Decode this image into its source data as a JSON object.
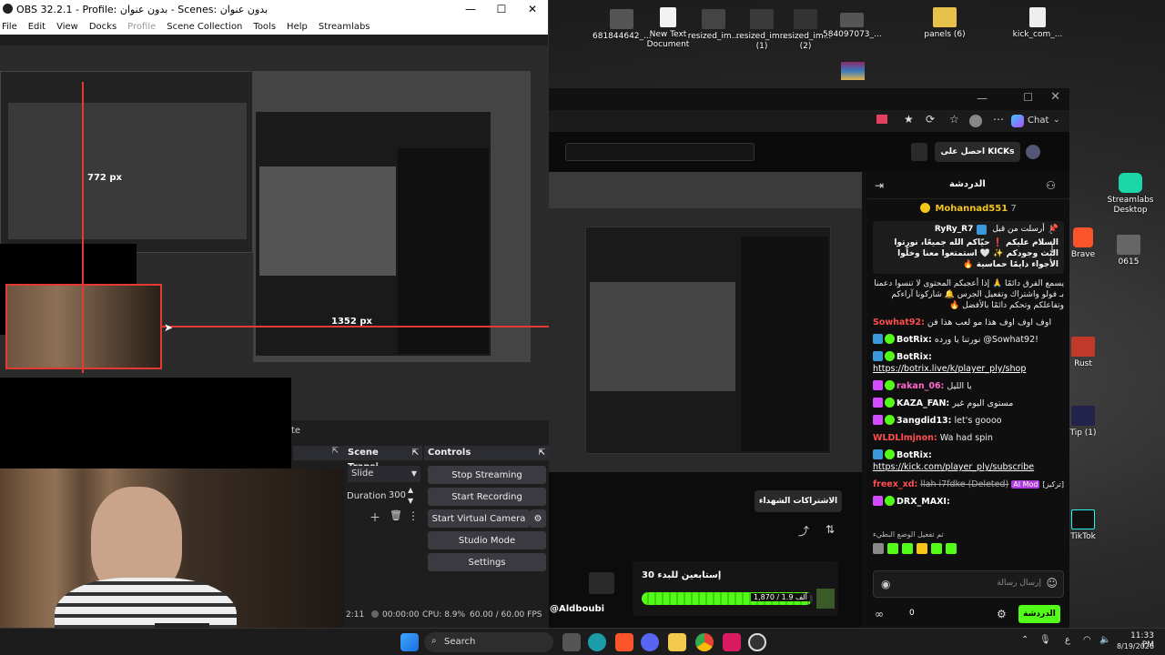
{
  "obs": {
    "title": "OBS 32.2.1 - Profile: بدون عنوان - Scenes: بدون عنوان",
    "menu": [
      "File",
      "Edit",
      "View",
      "Docks",
      "Profile",
      "Scene Collection",
      "Tools",
      "Help",
      "Streamlabs"
    ],
    "preview": {
      "measure_vertical": "772 px",
      "measure_horizontal": "1352 px"
    },
    "docks": {
      "transitions_title": "Scene Transi...",
      "transition_type": "Slide",
      "duration_label": "Duration",
      "duration_value": "300",
      "controls_title": "Controls",
      "controls": [
        "Stop Streaming",
        "Start Recording",
        "Start Virtual Camera",
        "Studio Mode",
        "Settings"
      ],
      "partial_label": "te"
    },
    "status": {
      "time_left": "2:11",
      "rec_time": "00:00:00",
      "cpu": "CPU: 8.9%",
      "fps": "60.00 / 60.00 FPS"
    }
  },
  "desktop": {
    "icons": [
      {
        "label": "681844642_...",
        "icon": "image-icon"
      },
      {
        "label": "New Text Document",
        "icon": "text-file-icon"
      },
      {
        "label": "resized_im...",
        "icon": "image-icon"
      },
      {
        "label": "resized_im... (1)",
        "icon": "image-icon"
      },
      {
        "label": "resized_im... (2)",
        "icon": "image-icon"
      },
      {
        "label": "584097073_...",
        "icon": "image-icon"
      },
      {
        "label": "panels (6)",
        "icon": "folder-icon"
      },
      {
        "label": "kick_com_...",
        "icon": "text-file-icon"
      }
    ],
    "right_icons": [
      {
        "label": "Streamlabs Desktop",
        "icon": "streamlabs-icon"
      },
      {
        "label": "Brave",
        "icon": "brave-icon"
      },
      {
        "label": "0615",
        "icon": "image-icon"
      },
      {
        "label": "Rust",
        "icon": "rust-icon"
      },
      {
        "label": "Tip (1)",
        "icon": "image-icon"
      },
      {
        "label": "TikTok",
        "icon": "tiktok-icon"
      }
    ]
  },
  "browser": {
    "chat_label": "Chat",
    "kicks_button": "احصل على KICKs",
    "chat_header": "الدردشة",
    "top_gifter": "Mohannad551",
    "top_gifter_count": "7",
    "pinned": {
      "by_label": "أرسلت من قبل",
      "user": "RyRy_R7",
      "text": "السلام عليكم ❗ حيّاكم الله جميعًا، نورتوا البث وجودكم ✨ 🤍 استمتعوا معنا وخلّوا الأجواء دايمًا حماسية 🔥"
    },
    "rules_text": "يسمع الفرق دائمًا 🙏 إذا أعجبكم المحتوى لا تنسوا دعمنا بـ فولو واشتراك وتفعيل الجرس 🔔 شاركونا آراءكم وتفاعلكم وتحكم دائمًا بالأفضل 🔥",
    "messages": [
      {
        "user": "Sowhat92:",
        "text": "اوف اوف اوف هذا مو لعب هذا فن",
        "color": "#ff4d4d",
        "badge": ""
      },
      {
        "user": "BotRix:",
        "text": "نورتنا يا ورده @Sowhat92!",
        "color": "#ffffff",
        "badge": "bot"
      },
      {
        "user": "BotRix:",
        "text": "https://botrix.live/k/player_ply/shop",
        "color": "#ffffff",
        "badge": "bot"
      },
      {
        "user": "rakan_06:",
        "text": "يا الليل",
        "color": "#ff66cc",
        "badge": "sub"
      },
      {
        "user": "KAZA_FAN:",
        "text": "مستوى اليوم غير",
        "color": "#ffffff",
        "badge": "sub"
      },
      {
        "user": "3angdid13:",
        "text": "let's goooo",
        "color": "#ffffff",
        "badge": "sub"
      },
      {
        "user": "WLDLlmjnon:",
        "text": "Wa had spin",
        "color": "#ff4d4d",
        "badge": ""
      },
      {
        "user": "BotRix:",
        "text": "https://kick.com/player_ply/subscribe",
        "color": "#ffffff",
        "badge": "bot"
      },
      {
        "user": "freex_xd:",
        "text": "llah i7fdke (Deleted)",
        "color": "#ff4d4d",
        "badge": "",
        "extra": "AI Mod",
        "tag": "[تركيز]"
      },
      {
        "user": "DRX_MAXI:",
        "text": "",
        "color": "#ffffff",
        "badge": "sub"
      }
    ],
    "emote_hint": "تم تفعيل الوضع البطيء",
    "input_placeholder": "إرسال رسالة",
    "send_button": "الدردشة",
    "footer_count": "0",
    "subs_button": "الاشتراكات الشهداء",
    "goal": {
      "title": "إستابعين للبدء 30",
      "progress_text": "1,870 / 1.9 ألف",
      "progress": 0.984
    },
    "streamer": "@Aldboubi"
  },
  "taskbar": {
    "search_label": "Search",
    "lang": "ع",
    "time": "11:33 PM",
    "date": "8/19/2026"
  }
}
